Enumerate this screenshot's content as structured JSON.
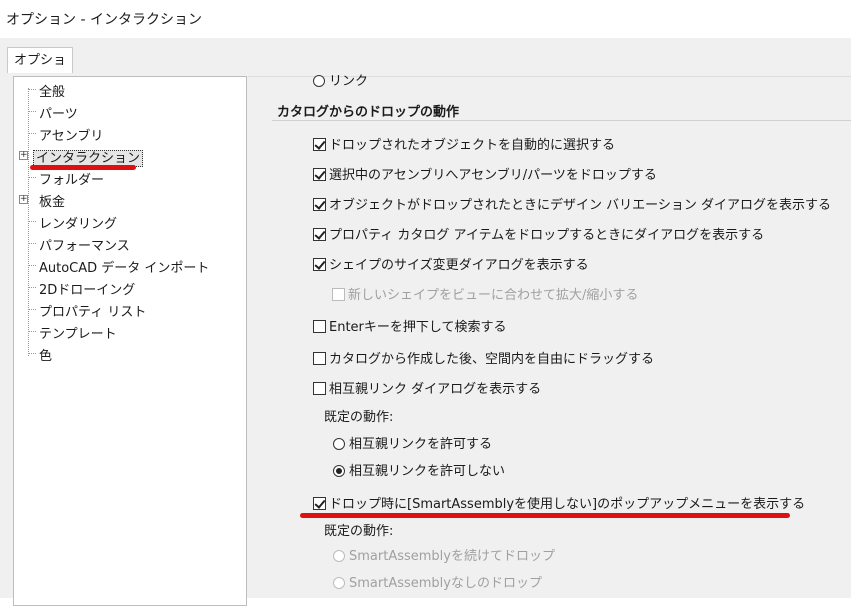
{
  "window": {
    "title": "オプション - インタラクション"
  },
  "tab": {
    "label": "オプション"
  },
  "tree": {
    "items": [
      {
        "label": "全般"
      },
      {
        "label": "パーツ"
      },
      {
        "label": "アセンブリ"
      },
      {
        "label": "インタラクション"
      },
      {
        "label": "フォルダー"
      },
      {
        "label": "板金"
      },
      {
        "label": "レンダリング"
      },
      {
        "label": "パフォーマンス"
      },
      {
        "label": "AutoCAD データ インポート"
      },
      {
        "label": "2Dドローイング"
      },
      {
        "label": "プロパティ リスト"
      },
      {
        "label": "テンプレート"
      },
      {
        "label": "色"
      }
    ],
    "selected": "インタラクション"
  },
  "content": {
    "partial_option": "リンク",
    "section_title": "カタログからのドロップの動作",
    "options": [
      {
        "label": "ドロップされたオブジェクトを自動的に選択する",
        "checked": true
      },
      {
        "label": "選択中のアセンブリへアセンブリ/パーツをドロップする",
        "checked": true
      },
      {
        "label": "オブジェクトがドロップされたときにデザイン バリエーション ダイアログを表示する",
        "checked": true
      },
      {
        "label": "プロパティ カタログ アイテムをドロップするときにダイアログを表示する",
        "checked": true
      },
      {
        "label": "シェイプのサイズ変更ダイアログを表示する",
        "checked": true
      },
      {
        "label": "新しいシェイプをビューに合わせて拡大/縮小する",
        "checked": false,
        "disabled": true
      },
      {
        "label": "Enterキーを押下して検索する",
        "checked": false
      },
      {
        "label": "カタログから作成した後、空間内を自由にドラッグする",
        "checked": false
      },
      {
        "label": "相互親リンク ダイアログを表示する",
        "checked": false
      }
    ],
    "default_action_label": "既定の動作:",
    "link_radios": [
      {
        "label": "相互親リンクを許可する",
        "selected": false
      },
      {
        "label": "相互親リンクを許可しない",
        "selected": true
      }
    ],
    "popup_option": {
      "label": "ドロップ時に[SmartAssemblyを使用しない]のポップアップメニューを表示する",
      "checked": true
    },
    "default_action_label2": "既定の動作:",
    "smart_radios": [
      {
        "label": "SmartAssemblyを続けてドロップ",
        "selected": false,
        "disabled": true
      },
      {
        "label": "SmartAssemblyなしのドロップ",
        "selected": false,
        "disabled": true
      }
    ]
  },
  "colors": {
    "annotation_red": "#e01010",
    "panel_bg": "#f0f0f0"
  }
}
